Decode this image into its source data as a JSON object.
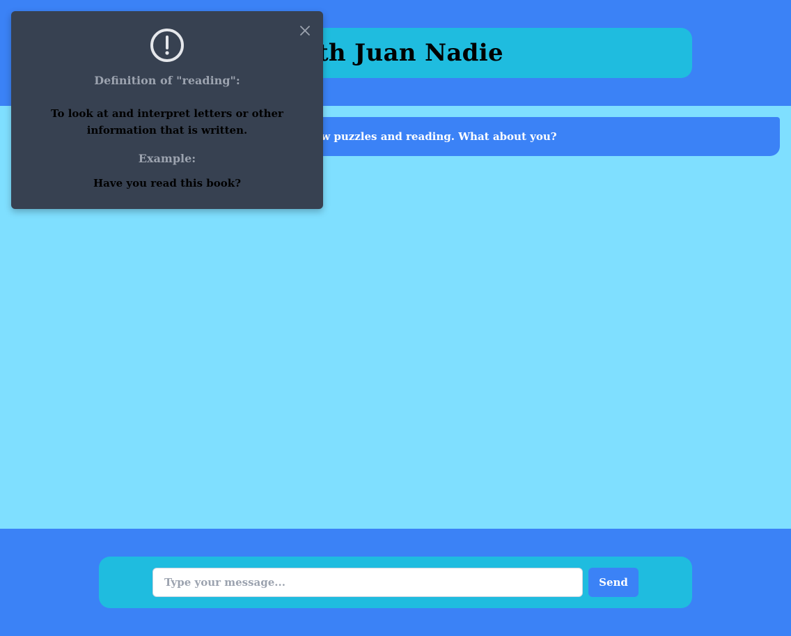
{
  "header": {
    "title": "with Juan Nadie"
  },
  "chat": {
    "messages": [
      {
        "text": "die. I like jigsaw puzzles and reading. What about you?"
      }
    ]
  },
  "composer": {
    "placeholder": "Type your message...",
    "value": "",
    "send_label": "Send"
  },
  "popup": {
    "icon": "exclamation-circle-icon",
    "close_icon": "close-icon",
    "definition_heading": "Definition of \"reading\":",
    "definition_text": "To look at and interpret letters or other information that is written.",
    "example_heading": "Example:",
    "example_text": "Have you read this book?"
  },
  "colors": {
    "header_bg": "#3b82f6",
    "title_box_bg": "#1fbcdf",
    "chat_bg": "#7fdfff",
    "bubble_bg": "#3b82f6",
    "popup_bg": "#374151",
    "popup_heading": "#9ca3af",
    "send_button": "#3b82f6"
  }
}
